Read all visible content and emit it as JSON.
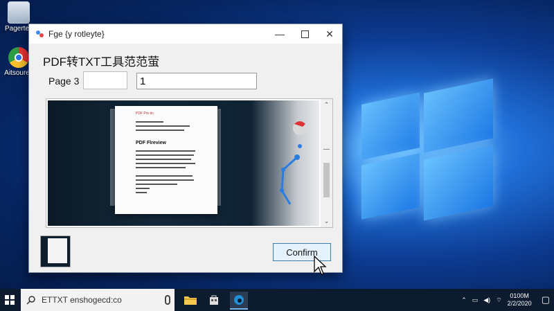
{
  "desktop": {
    "icons": [
      {
        "label": "Pagertes",
        "icon": "document-icon"
      },
      {
        "label": "Aitsoures",
        "icon": "chrome-icon"
      }
    ]
  },
  "window": {
    "title": "Fge {y rotleyte}",
    "heading": "PDF转TXT工具范范萤",
    "page_label": "Page 3",
    "page_box1_value": "",
    "page_box2_value": "1",
    "preview_doc": {
      "header": "PDF Pre tin",
      "title": "PDF Flreview"
    },
    "confirm_label": "Confirm"
  },
  "taskbar": {
    "search_text": "ETTXT enshogecd:co",
    "clock_time": "0100M",
    "clock_date": "2/2/2020"
  },
  "colors": {
    "accent": "#3c7fb1",
    "taskbar": "#0d1b2e",
    "window_bg": "#f0f0f0"
  }
}
